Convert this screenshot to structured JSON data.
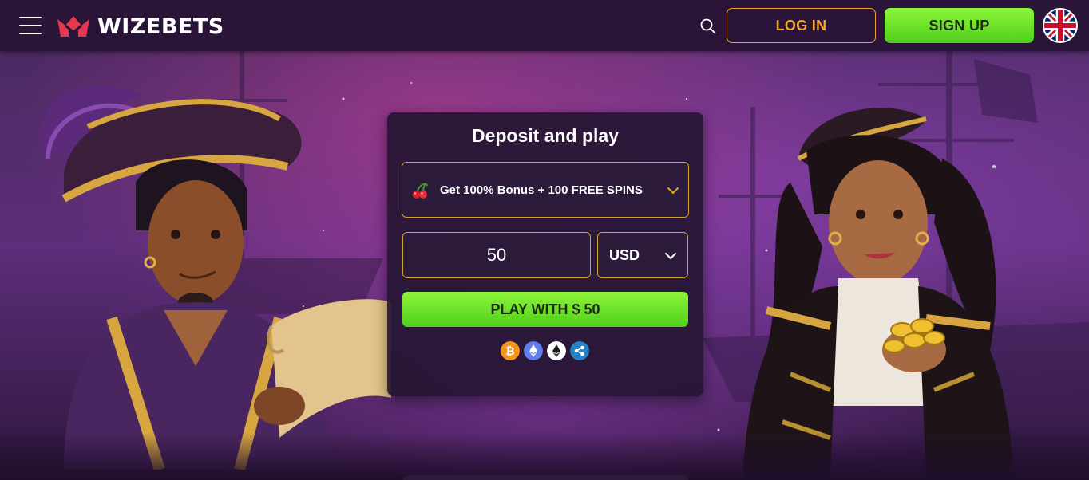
{
  "header": {
    "brand": "WIZEBETS",
    "login_label": "LOG IN",
    "signup_label": "SIGN UP",
    "icons": {
      "menu": "hamburger-menu-icon",
      "logo": "crown-logo-icon",
      "search": "search-icon",
      "language": "uk-flag-icon"
    }
  },
  "deposit": {
    "title": "Deposit and play",
    "bonus_label": "Get 100% Bonus + 100 FREE SPINS",
    "bonus_icon": "cherry-icon",
    "amount_value": "50",
    "currency": "USD",
    "play_label": "PLAY WITH $ 50",
    "payment_icons": [
      "bitcoin-icon",
      "ethereum-icon",
      "ethereum-classic-icon",
      "ripple-icon"
    ]
  },
  "colors": {
    "header_bg": "#2a1538",
    "accent_gold": "#f0a321",
    "accent_green": "#6be02a",
    "panel_bg": "#261634"
  }
}
